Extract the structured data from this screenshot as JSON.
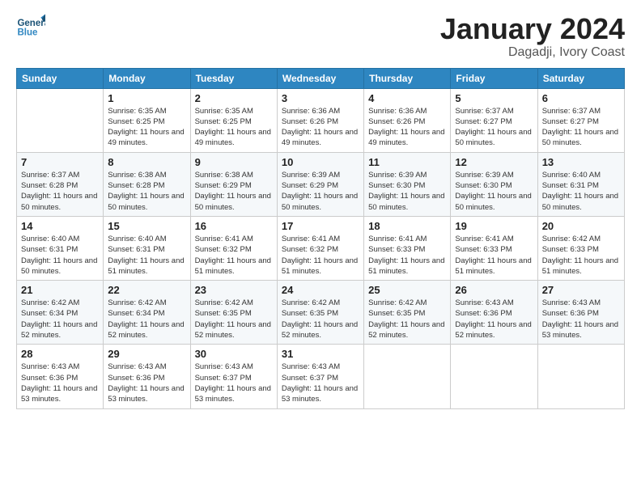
{
  "logo": {
    "line1": "General",
    "line2": "Blue"
  },
  "title": "January 2024",
  "subtitle": "Dagadji, Ivory Coast",
  "weekdays": [
    "Sunday",
    "Monday",
    "Tuesday",
    "Wednesday",
    "Thursday",
    "Friday",
    "Saturday"
  ],
  "weeks": [
    [
      {
        "day": "",
        "sunrise": "",
        "sunset": "",
        "daylight": ""
      },
      {
        "day": "1",
        "sunrise": "Sunrise: 6:35 AM",
        "sunset": "Sunset: 6:25 PM",
        "daylight": "Daylight: 11 hours and 49 minutes."
      },
      {
        "day": "2",
        "sunrise": "Sunrise: 6:35 AM",
        "sunset": "Sunset: 6:25 PM",
        "daylight": "Daylight: 11 hours and 49 minutes."
      },
      {
        "day": "3",
        "sunrise": "Sunrise: 6:36 AM",
        "sunset": "Sunset: 6:26 PM",
        "daylight": "Daylight: 11 hours and 49 minutes."
      },
      {
        "day": "4",
        "sunrise": "Sunrise: 6:36 AM",
        "sunset": "Sunset: 6:26 PM",
        "daylight": "Daylight: 11 hours and 49 minutes."
      },
      {
        "day": "5",
        "sunrise": "Sunrise: 6:37 AM",
        "sunset": "Sunset: 6:27 PM",
        "daylight": "Daylight: 11 hours and 50 minutes."
      },
      {
        "day": "6",
        "sunrise": "Sunrise: 6:37 AM",
        "sunset": "Sunset: 6:27 PM",
        "daylight": "Daylight: 11 hours and 50 minutes."
      }
    ],
    [
      {
        "day": "7",
        "sunrise": "Sunrise: 6:37 AM",
        "sunset": "Sunset: 6:28 PM",
        "daylight": "Daylight: 11 hours and 50 minutes."
      },
      {
        "day": "8",
        "sunrise": "Sunrise: 6:38 AM",
        "sunset": "Sunset: 6:28 PM",
        "daylight": "Daylight: 11 hours and 50 minutes."
      },
      {
        "day": "9",
        "sunrise": "Sunrise: 6:38 AM",
        "sunset": "Sunset: 6:29 PM",
        "daylight": "Daylight: 11 hours and 50 minutes."
      },
      {
        "day": "10",
        "sunrise": "Sunrise: 6:39 AM",
        "sunset": "Sunset: 6:29 PM",
        "daylight": "Daylight: 11 hours and 50 minutes."
      },
      {
        "day": "11",
        "sunrise": "Sunrise: 6:39 AM",
        "sunset": "Sunset: 6:30 PM",
        "daylight": "Daylight: 11 hours and 50 minutes."
      },
      {
        "day": "12",
        "sunrise": "Sunrise: 6:39 AM",
        "sunset": "Sunset: 6:30 PM",
        "daylight": "Daylight: 11 hours and 50 minutes."
      },
      {
        "day": "13",
        "sunrise": "Sunrise: 6:40 AM",
        "sunset": "Sunset: 6:31 PM",
        "daylight": "Daylight: 11 hours and 50 minutes."
      }
    ],
    [
      {
        "day": "14",
        "sunrise": "Sunrise: 6:40 AM",
        "sunset": "Sunset: 6:31 PM",
        "daylight": "Daylight: 11 hours and 50 minutes."
      },
      {
        "day": "15",
        "sunrise": "Sunrise: 6:40 AM",
        "sunset": "Sunset: 6:31 PM",
        "daylight": "Daylight: 11 hours and 51 minutes."
      },
      {
        "day": "16",
        "sunrise": "Sunrise: 6:41 AM",
        "sunset": "Sunset: 6:32 PM",
        "daylight": "Daylight: 11 hours and 51 minutes."
      },
      {
        "day": "17",
        "sunrise": "Sunrise: 6:41 AM",
        "sunset": "Sunset: 6:32 PM",
        "daylight": "Daylight: 11 hours and 51 minutes."
      },
      {
        "day": "18",
        "sunrise": "Sunrise: 6:41 AM",
        "sunset": "Sunset: 6:33 PM",
        "daylight": "Daylight: 11 hours and 51 minutes."
      },
      {
        "day": "19",
        "sunrise": "Sunrise: 6:41 AM",
        "sunset": "Sunset: 6:33 PM",
        "daylight": "Daylight: 11 hours and 51 minutes."
      },
      {
        "day": "20",
        "sunrise": "Sunrise: 6:42 AM",
        "sunset": "Sunset: 6:33 PM",
        "daylight": "Daylight: 11 hours and 51 minutes."
      }
    ],
    [
      {
        "day": "21",
        "sunrise": "Sunrise: 6:42 AM",
        "sunset": "Sunset: 6:34 PM",
        "daylight": "Daylight: 11 hours and 52 minutes."
      },
      {
        "day": "22",
        "sunrise": "Sunrise: 6:42 AM",
        "sunset": "Sunset: 6:34 PM",
        "daylight": "Daylight: 11 hours and 52 minutes."
      },
      {
        "day": "23",
        "sunrise": "Sunrise: 6:42 AM",
        "sunset": "Sunset: 6:35 PM",
        "daylight": "Daylight: 11 hours and 52 minutes."
      },
      {
        "day": "24",
        "sunrise": "Sunrise: 6:42 AM",
        "sunset": "Sunset: 6:35 PM",
        "daylight": "Daylight: 11 hours and 52 minutes."
      },
      {
        "day": "25",
        "sunrise": "Sunrise: 6:42 AM",
        "sunset": "Sunset: 6:35 PM",
        "daylight": "Daylight: 11 hours and 52 minutes."
      },
      {
        "day": "26",
        "sunrise": "Sunrise: 6:43 AM",
        "sunset": "Sunset: 6:36 PM",
        "daylight": "Daylight: 11 hours and 52 minutes."
      },
      {
        "day": "27",
        "sunrise": "Sunrise: 6:43 AM",
        "sunset": "Sunset: 6:36 PM",
        "daylight": "Daylight: 11 hours and 53 minutes."
      }
    ],
    [
      {
        "day": "28",
        "sunrise": "Sunrise: 6:43 AM",
        "sunset": "Sunset: 6:36 PM",
        "daylight": "Daylight: 11 hours and 53 minutes."
      },
      {
        "day": "29",
        "sunrise": "Sunrise: 6:43 AM",
        "sunset": "Sunset: 6:36 PM",
        "daylight": "Daylight: 11 hours and 53 minutes."
      },
      {
        "day": "30",
        "sunrise": "Sunrise: 6:43 AM",
        "sunset": "Sunset: 6:37 PM",
        "daylight": "Daylight: 11 hours and 53 minutes."
      },
      {
        "day": "31",
        "sunrise": "Sunrise: 6:43 AM",
        "sunset": "Sunset: 6:37 PM",
        "daylight": "Daylight: 11 hours and 53 minutes."
      },
      {
        "day": "",
        "sunrise": "",
        "sunset": "",
        "daylight": ""
      },
      {
        "day": "",
        "sunrise": "",
        "sunset": "",
        "daylight": ""
      },
      {
        "day": "",
        "sunrise": "",
        "sunset": "",
        "daylight": ""
      }
    ]
  ]
}
